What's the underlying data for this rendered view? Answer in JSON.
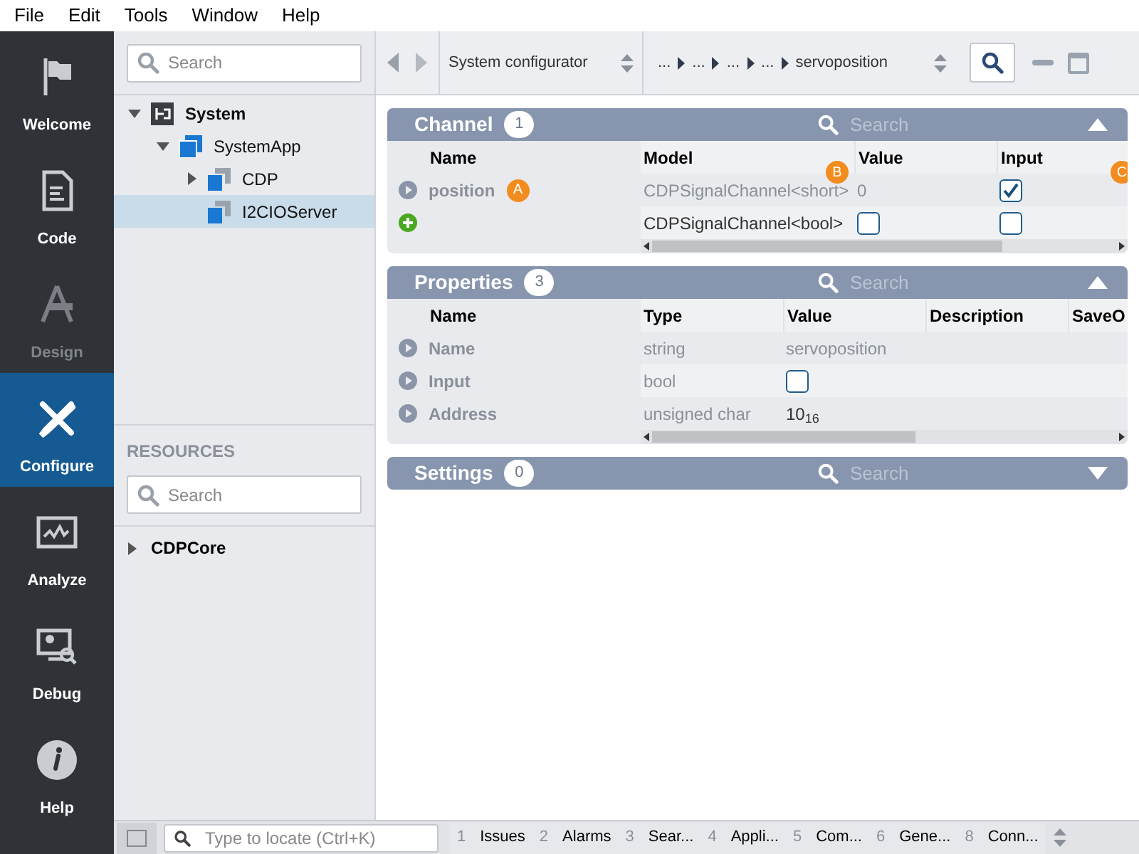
{
  "menu": [
    "File",
    "Edit",
    "Tools",
    "Window",
    "Help"
  ],
  "sidebar": {
    "items": [
      {
        "label": "Welcome",
        "kind": "flag",
        "selected": false,
        "disabled": false
      },
      {
        "label": "Code",
        "kind": "document",
        "selected": false,
        "disabled": false
      },
      {
        "label": "Design",
        "kind": "design",
        "selected": false,
        "disabled": true
      },
      {
        "label": "Configure",
        "kind": "tools",
        "selected": true,
        "disabled": false
      },
      {
        "label": "Analyze",
        "kind": "chart",
        "selected": false,
        "disabled": false
      },
      {
        "label": "Debug",
        "kind": "debug",
        "selected": false,
        "disabled": false
      },
      {
        "label": "Help",
        "kind": "info",
        "selected": false,
        "disabled": false
      }
    ]
  },
  "project_tree": {
    "search": {
      "placeholder": "Search"
    },
    "items": [
      {
        "label": "System",
        "kind": "system",
        "expanded": true,
        "selected": false,
        "children": [
          {
            "label": "SystemApp",
            "kind": "app",
            "expanded": true,
            "selected": false,
            "children": [
              {
                "label": "CDP",
                "kind": "component",
                "expanded": false,
                "selected": false
              },
              {
                "label": "I2CIOServer",
                "kind": "component",
                "selected": true
              }
            ]
          }
        ]
      }
    ]
  },
  "resources": {
    "heading": "RESOURCES",
    "search": {
      "placeholder": "Search"
    },
    "items": [
      {
        "label": "CDPCore",
        "expanded": false,
        "selected": false
      }
    ]
  },
  "toolbar": {
    "view": "System configurator",
    "breadcrumb": [
      "...",
      "...",
      "...",
      "...",
      "servoposition"
    ]
  },
  "panels": [
    {
      "title": "Channel",
      "count": "1",
      "search_placeholder": "Search",
      "expanded": true,
      "columns": [
        "Name",
        "Model",
        "Value",
        "Input"
      ],
      "rows": [
        {
          "kind": "item",
          "dimmed": true,
          "cells": [
            {
              "kind": "text",
              "text": "position",
              "badge": "A"
            },
            {
              "kind": "text",
              "text": "CDPSignalChannel<short>",
              "badge": "B"
            },
            {
              "kind": "text",
              "text": "0"
            },
            {
              "kind": "checkbox",
              "checked": true,
              "badge": "C"
            }
          ]
        },
        {
          "kind": "new",
          "dimmed": false,
          "cells": [
            "",
            {
              "kind": "text",
              "text": "CDPSignalChannel<bool>"
            },
            {
              "kind": "checkbox",
              "checked": false
            },
            {
              "kind": "checkbox",
              "checked": false
            }
          ]
        }
      ]
    },
    {
      "title": "Properties",
      "count": "3",
      "search_placeholder": "Search",
      "expanded": true,
      "columns": [
        "Name",
        "Type",
        "Value",
        "Description",
        "SaveO"
      ],
      "rows": [
        {
          "kind": "item",
          "dimmed": true,
          "cells": [
            {
              "kind": "text",
              "text": "Name"
            },
            {
              "kind": "text",
              "text": "string"
            },
            {
              "kind": "text",
              "text": "servoposition"
            }
          ]
        },
        {
          "kind": "item",
          "dimmed": true,
          "cells": [
            {
              "kind": "text",
              "text": "Input"
            },
            {
              "kind": "text",
              "text": "bool"
            },
            {
              "kind": "checkbox",
              "checked": false
            }
          ]
        },
        {
          "kind": "item",
          "dimmed": true,
          "cells": [
            {
              "kind": "text",
              "text": "Address"
            },
            {
              "kind": "text",
              "text": "unsigned char"
            },
            {
              "kind": "rich",
              "text": "10$_{16}$"
            }
          ]
        }
      ]
    },
    {
      "title": "Settings",
      "count": "0",
      "search_placeholder": "Search",
      "expanded": false
    }
  ],
  "status_bar": {
    "locate": {
      "placeholder": "Type to locate (Ctrl+K)"
    },
    "tabs": [
      {
        "number": "1",
        "label": "Issues"
      },
      {
        "number": "2",
        "label": "Alarms"
      },
      {
        "number": "3",
        "label": "Sear..."
      },
      {
        "number": "4",
        "label": "Appli..."
      },
      {
        "number": "5",
        "label": "Com..."
      },
      {
        "number": "6",
        "label": "Gene..."
      },
      {
        "number": "8",
        "label": "Conn..."
      }
    ]
  }
}
